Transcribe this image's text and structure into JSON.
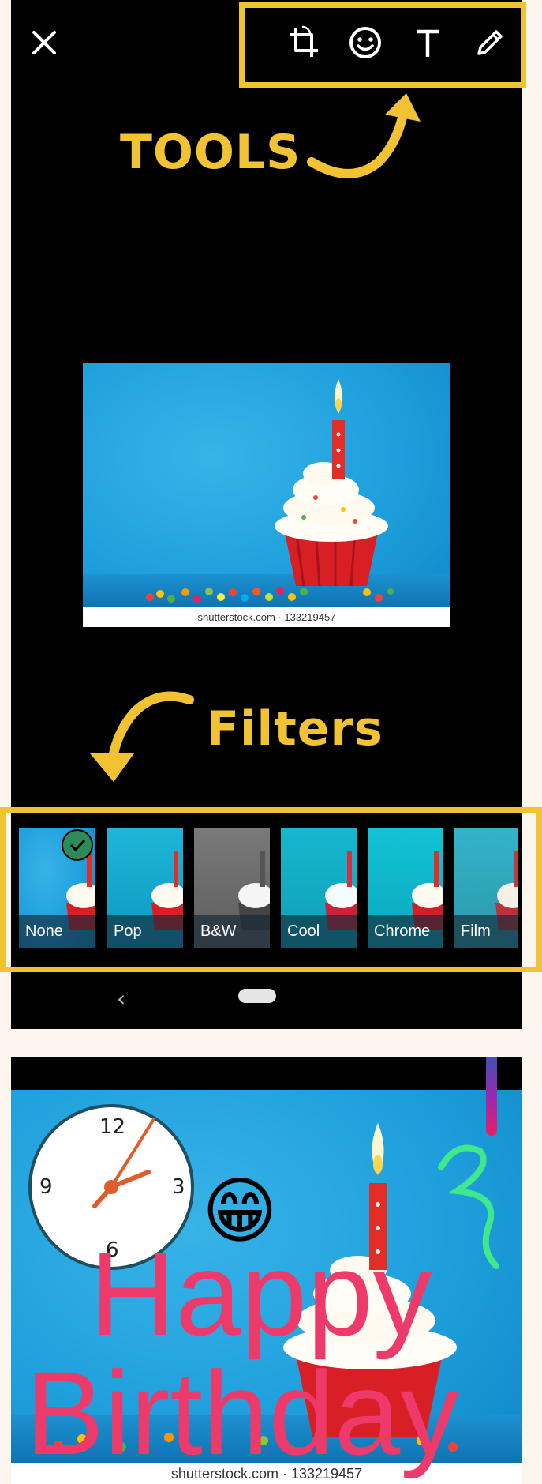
{
  "annotations": {
    "tools_label": "TOOLS",
    "filters_label": "Filters",
    "accent_color": "#f1c232"
  },
  "editor": {
    "close_icon": "close-icon",
    "tools": [
      {
        "name": "crop-rotate-icon"
      },
      {
        "name": "emoji-sticker-icon"
      },
      {
        "name": "text-icon",
        "glyph": "T"
      },
      {
        "name": "pencil-draw-icon"
      }
    ],
    "photo_watermark": "shutterstock.com · 133219457",
    "filters": [
      {
        "label": "None",
        "selected": true
      },
      {
        "label": "Pop",
        "selected": false
      },
      {
        "label": "B&W",
        "selected": false
      },
      {
        "label": "Cool",
        "selected": false
      },
      {
        "label": "Chrome",
        "selected": false
      },
      {
        "label": "Film",
        "selected": false
      }
    ],
    "nav": {
      "back_glyph": "‹"
    }
  },
  "edited": {
    "text_line1": "Happy",
    "text_line2": "Birthday",
    "text_color": "#ee3a6a",
    "emoji": "😁",
    "clock_numbers": {
      "n12": "12",
      "n3": "3",
      "n6": "6",
      "n9": "9"
    },
    "doodle_color": "#3ee88b",
    "photo_watermark": "shutterstock.com · 133219457",
    "color_picker_colors": [
      "#3f51b5",
      "#9c27b0",
      "#e91e63"
    ]
  }
}
